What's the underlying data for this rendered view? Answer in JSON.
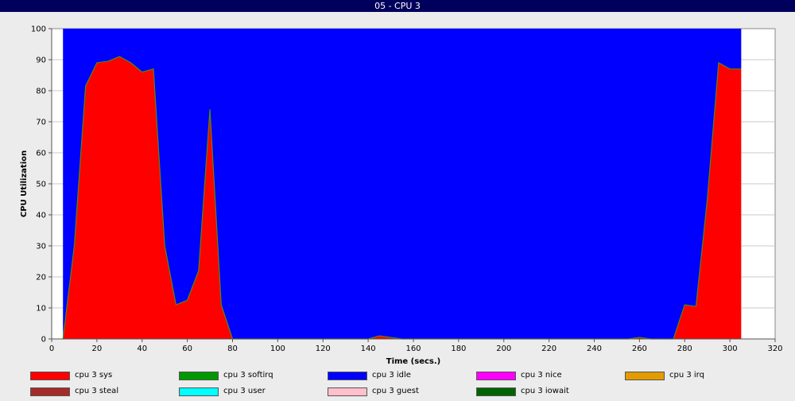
{
  "window": {
    "title": "05 - CPU 3"
  },
  "chart_data": {
    "type": "area",
    "stacked": true,
    "xlabel": "Time (secs.)",
    "ylabel": "CPU Utilization",
    "xlim": [
      0,
      320
    ],
    "ylim": [
      0,
      100
    ],
    "xticks": [
      0,
      20,
      40,
      60,
      80,
      100,
      120,
      140,
      160,
      180,
      200,
      220,
      240,
      260,
      280,
      300,
      320
    ],
    "yticks": [
      0,
      10,
      20,
      30,
      40,
      50,
      60,
      70,
      80,
      90,
      100
    ],
    "grid": "horizontal",
    "legend_position": "bottom",
    "x": [
      5,
      10,
      15,
      20,
      25,
      30,
      35,
      40,
      45,
      50,
      55,
      60,
      65,
      70,
      75,
      80,
      85,
      90,
      95,
      100,
      105,
      110,
      115,
      120,
      125,
      130,
      135,
      140,
      145,
      150,
      155,
      160,
      165,
      170,
      175,
      180,
      185,
      190,
      195,
      200,
      205,
      210,
      215,
      220,
      225,
      230,
      235,
      240,
      245,
      250,
      255,
      260,
      265,
      270,
      275,
      280,
      285,
      290,
      295,
      300,
      305
    ],
    "series": [
      {
        "name": "cpu 3 sys",
        "color": "#ff0000",
        "values": [
          0,
          30,
          81.5,
          89,
          89.5,
          91,
          89,
          86,
          87,
          30,
          11,
          12.5,
          22,
          74,
          11,
          0,
          0,
          0,
          0,
          0,
          0,
          0,
          0,
          0,
          0,
          0,
          0,
          0,
          1,
          0.5,
          0,
          0,
          0,
          0,
          0,
          0,
          0,
          0,
          0,
          0,
          0,
          0,
          0,
          0,
          0,
          0,
          0,
          0,
          0,
          0,
          0,
          0.5,
          0,
          0,
          0,
          11,
          10.5,
          45,
          89,
          87,
          87
        ]
      },
      {
        "name": "cpu 3 softirq",
        "color": "#009900",
        "values": [
          0,
          0,
          0,
          0,
          0,
          0,
          0,
          0,
          0,
          0,
          0,
          0,
          0,
          0,
          0,
          0,
          0,
          0,
          0,
          0,
          0,
          0,
          0,
          0,
          0,
          0,
          0,
          0,
          0,
          0,
          0,
          0,
          0,
          0,
          0,
          0,
          0,
          0,
          0,
          0,
          0,
          0,
          0,
          0,
          0,
          0,
          0,
          0,
          0,
          0,
          0,
          0,
          0,
          0,
          0,
          0,
          0,
          0,
          0,
          0,
          0
        ]
      },
      {
        "name": "cpu 3 idle",
        "color": "#0000ff",
        "values": [
          100,
          70,
          18.5,
          11,
          10.5,
          9,
          11,
          14,
          13,
          70,
          89,
          87.5,
          78,
          26,
          89,
          100,
          100,
          100,
          100,
          100,
          100,
          100,
          100,
          100,
          100,
          100,
          100,
          100,
          99,
          99.5,
          100,
          100,
          100,
          100,
          100,
          100,
          100,
          100,
          100,
          100,
          100,
          100,
          100,
          100,
          100,
          100,
          100,
          100,
          100,
          100,
          100,
          99.5,
          100,
          100,
          100,
          89,
          89.5,
          55,
          11,
          13,
          13
        ]
      },
      {
        "name": "cpu 3 nice",
        "color": "#ff00ff",
        "values": []
      },
      {
        "name": "cpu 3 irq",
        "color": "#e39b00",
        "values": []
      },
      {
        "name": "cpu 3 steal",
        "color": "#a52a2a",
        "values": []
      },
      {
        "name": "cpu 3 user",
        "color": "#00ffff",
        "values": []
      },
      {
        "name": "cpu 3 guest",
        "color": "#ffc0cb",
        "values": []
      },
      {
        "name": "cpu 3 iowait",
        "color": "#006400",
        "values": []
      }
    ]
  }
}
